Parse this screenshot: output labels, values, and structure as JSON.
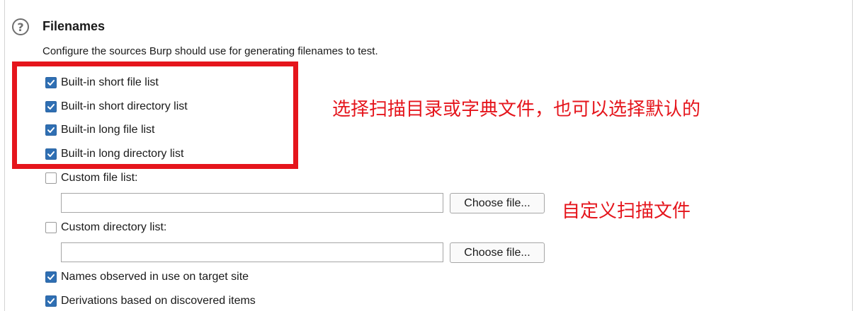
{
  "section": {
    "help_icon": "?",
    "title": "Filenames",
    "description": "Configure the sources Burp should use for generating filenames to test."
  },
  "options": [
    {
      "label": "Built-in short file list",
      "checked": true
    },
    {
      "label": "Built-in short directory list",
      "checked": true
    },
    {
      "label": "Built-in long file list",
      "checked": true
    },
    {
      "label": "Built-in long directory list",
      "checked": true
    },
    {
      "label": "Custom file list:",
      "checked": false
    },
    {
      "label": "Custom directory list:",
      "checked": false
    },
    {
      "label": "Names observed in use on target site",
      "checked": true
    },
    {
      "label": "Derivations based on discovered items",
      "checked": true
    }
  ],
  "custom_file": {
    "value": "",
    "button_label": "Choose file..."
  },
  "custom_directory": {
    "value": "",
    "button_label": "Choose file..."
  },
  "annotations": {
    "builtin_note": "选择扫描目录或字典文件，也可以选择默认的",
    "custom_note": "自定义扫描文件"
  },
  "colors": {
    "checkbox_checked": "#2f6fb3",
    "annotation_red": "#e5151c"
  }
}
